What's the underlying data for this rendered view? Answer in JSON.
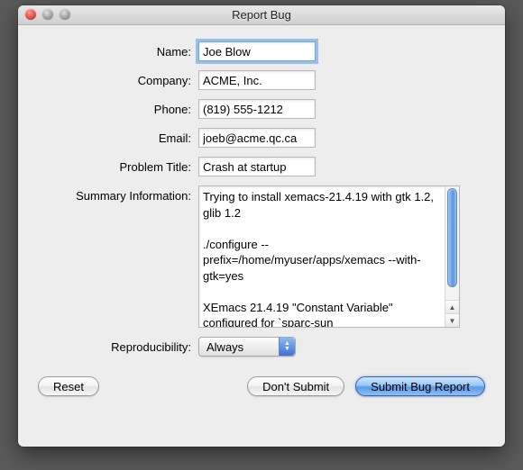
{
  "window": {
    "title": "Report Bug"
  },
  "labels": {
    "name": "Name:",
    "company": "Company:",
    "phone": "Phone:",
    "email": "Email:",
    "problem_title": "Problem Title:",
    "summary": "Summary Information:",
    "reproducibility": "Reproducibility:"
  },
  "fields": {
    "name": "Joe Blow",
    "company": "ACME, Inc.",
    "phone": "(819) 555-1212",
    "email": "joeb@acme.qc.ca",
    "problem_title": "Crash at startup",
    "summary": "Trying to install xemacs-21.4.19 with gtk 1.2, glib 1.2\n\n./configure --prefix=/home/myuser/apps/xemacs --with-gtk=yes\n\nXEmacs 21.4.19 \"Constant Variable\" configured for `sparc-sun",
    "reproducibility": "Always"
  },
  "buttons": {
    "reset": "Reset",
    "dont_submit": "Don't Submit",
    "submit": "Submit Bug Report"
  }
}
